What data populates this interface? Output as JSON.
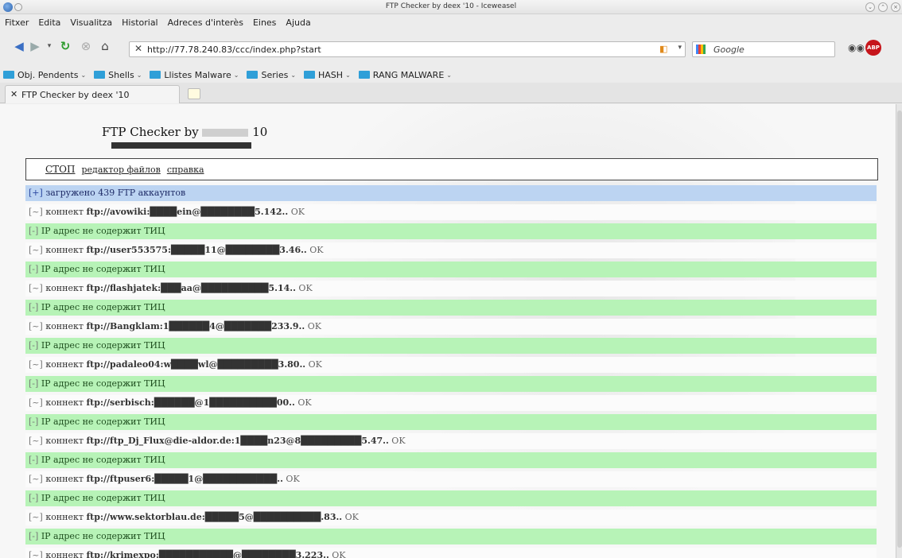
{
  "window": {
    "title": "FTP Checker by deex '10 - Iceweasel"
  },
  "menubar": [
    "Fitxer",
    "Edita",
    "Visualitza",
    "Historial",
    "Adreces d'interès",
    "Eines",
    "Ajuda"
  ],
  "toolbar": {
    "url": "http://77.78.240.83/ccc/index.php?start",
    "search_engine": "Google",
    "adblock_label": "ABP"
  },
  "bookmarks": [
    "Obj. Pendents",
    "Shells",
    "Llistes Malware",
    "Series",
    "HASH",
    "RANG MALWARE"
  ],
  "tabs": [
    {
      "label": "FTP Checker by deex '10"
    }
  ],
  "page": {
    "heading_left": "FTP Checker by",
    "heading_right": "10",
    "menu": [
      {
        "label": "СТОП"
      },
      {
        "label": "редактор файлов"
      },
      {
        "label": "справка"
      }
    ],
    "log": [
      {
        "type": "info",
        "tag": "[+]",
        "text": "загружено 439 FTP аккаунтов"
      },
      {
        "type": "conn",
        "tag": "[~]",
        "prefix": "коннект",
        "ftp": "ftp://avowiki:████ein@████████5.142..",
        "ok": "OK"
      },
      {
        "type": "ip",
        "tag": "[-]",
        "text": "IP адрес не содержит ТИЦ"
      },
      {
        "type": "conn",
        "tag": "[~]",
        "prefix": "коннект",
        "ftp": "ftp://user553575:█████11@████████3.46..",
        "ok": "OK"
      },
      {
        "type": "ip",
        "tag": "[-]",
        "text": "IP адрес не содержит ТИЦ"
      },
      {
        "type": "conn",
        "tag": "[~]",
        "prefix": "коннект",
        "ftp": "ftp://flashjatek:███aa@██████████5.14..",
        "ok": "OK"
      },
      {
        "type": "ip",
        "tag": "[-]",
        "text": "IP адрес не содержит ТИЦ"
      },
      {
        "type": "conn",
        "tag": "[~]",
        "prefix": "коннект",
        "ftp": "ftp://Bangklam:1██████4@███████233.9..",
        "ok": "OK"
      },
      {
        "type": "ip",
        "tag": "[-]",
        "text": "IP адрес не содержит ТИЦ"
      },
      {
        "type": "conn",
        "tag": "[~]",
        "prefix": "коннект",
        "ftp": "ftp://padaleo04:w████wl@█████████3.80..",
        "ok": "OK"
      },
      {
        "type": "ip",
        "tag": "[-]",
        "text": "IP адрес не содержит ТИЦ"
      },
      {
        "type": "conn",
        "tag": "[~]",
        "prefix": "коннект",
        "ftp": "ftp://serbisch:██████@1██████████00..",
        "ok": "OK"
      },
      {
        "type": "ip",
        "tag": "[-]",
        "text": "IP адрес не содержит ТИЦ"
      },
      {
        "type": "conn",
        "tag": "[~]",
        "prefix": "коннект",
        "ftp": "ftp://ftp_Dj_Flux@die-aldor.de:1████n23@8█████████5.47..",
        "ok": "OK"
      },
      {
        "type": "ip",
        "tag": "[-]",
        "text": "IP адрес не содержит ТИЦ"
      },
      {
        "type": "conn",
        "tag": "[~]",
        "prefix": "коннект",
        "ftp": "ftp://ftpuser6:█████1@███████████..",
        "ok": "OK"
      },
      {
        "type": "ip",
        "tag": "[-]",
        "text": "IP адрес не содержит ТИЦ"
      },
      {
        "type": "conn",
        "tag": "[~]",
        "prefix": "коннект",
        "ftp": "ftp://www.sektorblau.de:█████5@██████████.83..",
        "ok": "OK"
      },
      {
        "type": "ip",
        "tag": "[-]",
        "text": "IP адрес не содержит ТИЦ"
      },
      {
        "type": "conn",
        "tag": "[~]",
        "prefix": "коннект",
        "ftp": "ftp://krimexpo:███████████@████████3.223..",
        "ok": "OK"
      }
    ]
  }
}
